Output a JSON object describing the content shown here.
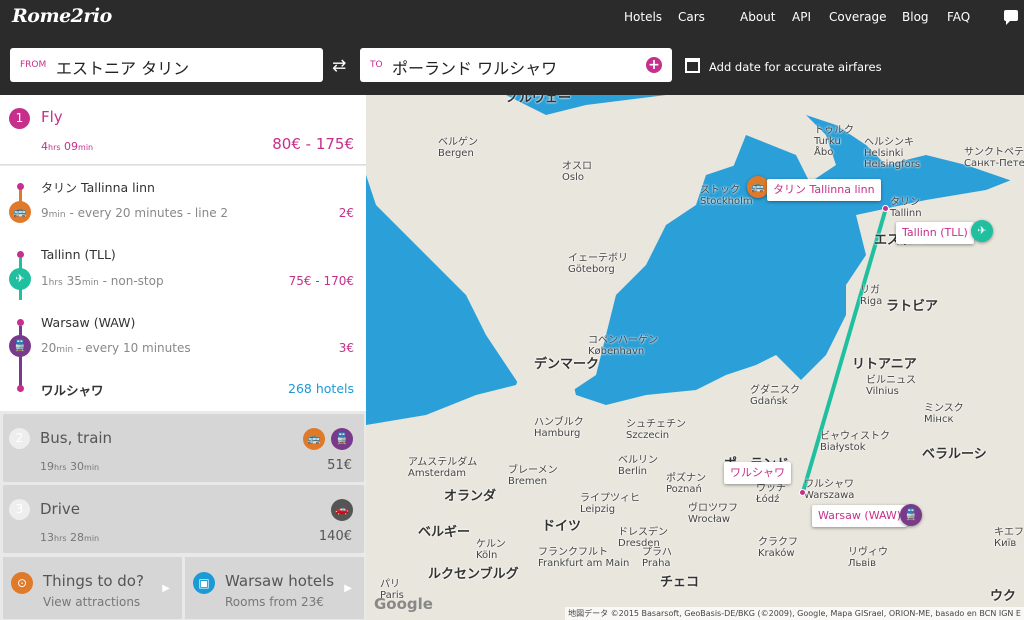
{
  "brand": {
    "name": "Rome2rio"
  },
  "nav": {
    "hotels": "Hotels",
    "cars": "Cars",
    "about": "About",
    "api": "API",
    "coverage": "Coverage",
    "blog": "Blog",
    "faq": "FAQ"
  },
  "search": {
    "from_label": "FROM",
    "from_value": "エストニア タリン",
    "to_label": "TO",
    "to_value": "ポーランド ワルシャワ",
    "date_text": "Add date for accurate airfares",
    "plus": "+"
  },
  "colors": {
    "accent": "#c62f8b",
    "bus": "#e07a2b",
    "plane": "#1fbfa0",
    "train": "#7a3a8c",
    "link": "#1a9bd6",
    "sea": "#2b9fd8"
  },
  "route": {
    "number": "1",
    "title": "Fly",
    "duration_value": "4",
    "duration_unit_h": "hrs",
    "duration_min": "09",
    "duration_unit_m": "min",
    "price": "80€ - 175€",
    "segments": [
      {
        "place_jp": "タリン",
        "place": "Tallinna linn",
        "icon": "bus-icon",
        "info_num": "9",
        "info_unit": "min",
        "info_rest": " - every 20 minutes - line 2",
        "price": "2€"
      },
      {
        "place": "Tallinn (TLL)",
        "icon": "plane-icon",
        "info_num": "1",
        "info_unit": "hrs",
        "info_num2": "35",
        "info_unit2": "min",
        "info_rest": " - non-stop",
        "price": "75€ - 170€"
      },
      {
        "place": "Warsaw (WAW)",
        "icon": "train-icon",
        "info_num": "20",
        "info_unit": "min",
        "info_rest": " - every 10 minutes",
        "price": "3€"
      }
    ],
    "destination": "ワルシャワ",
    "hotels": "268 hotels"
  },
  "options": [
    {
      "number": "2",
      "title": "Bus, train",
      "dur_h": "19",
      "unit_h": "hrs",
      "dur_m": "30",
      "unit_m": "min",
      "price": "51€"
    },
    {
      "number": "3",
      "title": "Drive",
      "dur_h": "13",
      "unit_h": "hrs",
      "dur_m": "28",
      "unit_m": "min",
      "price": "140€"
    }
  ],
  "tiles": [
    {
      "title": "Things to do?",
      "sub": "View attractions"
    },
    {
      "title": "Warsaw hotels",
      "sub": "Rooms from 23€"
    }
  ],
  "map": {
    "labels": {
      "norway": "ノルウェー",
      "bergen_jp": "ベルゲン",
      "bergen": "Bergen",
      "oslo_jp": "オスロ",
      "oslo": "Oslo",
      "stockholm_jp": "ストック",
      "stockholm": "Stockholm",
      "turku_jp": "トゥルク",
      "turku": "Turku",
      "abo": "Åbo",
      "helsinki_jp": "ヘルシンキ",
      "helsinki": "Helsinki",
      "helsingfors": "Helsingfors",
      "spb_jp": "サンクトペテ",
      "spb": "Санкт-Петер",
      "goteborg_jp": "イェーテボリ",
      "goteborg": "Göteborg",
      "estonia": "エストニ",
      "tallinn_jp": "タリン",
      "tallinn": "Tallinn",
      "latvia": "ラトビア",
      "riga_jp": "リガ",
      "riga": "Riga",
      "copenhagen_jp": "コペンハーゲン",
      "copenhagen": "København",
      "denmark": "デンマーク",
      "lithuania": "リトアニア",
      "vilnius_jp": "ビルニュス",
      "vilnius": "Vilnius",
      "gdansk_jp": "グダニスク",
      "gdansk": "Gdańsk",
      "minsk_jp": "ミンスク",
      "minsk": "Мінск",
      "hamburg_jp": "ハンブルク",
      "hamburg": "Hamburg",
      "szczecin_jp": "シュチェチン",
      "szczecin": "Szczecin",
      "bialystok_jp": "ビャウィストク",
      "bialystok": "Białystok",
      "belarus": "ベラルーシ",
      "amsterdam_jp": "アムステルダム",
      "amsterdam": "Amsterdam",
      "bremen_jp": "ブレーメン",
      "bremen": "Bremen",
      "berlin_jp": "ベルリン",
      "berlin": "Berlin",
      "poznan_jp": "ポズナン",
      "poznan": "Poznań",
      "netherlands": "オランダ",
      "leipzig_jp": "ライプツィヒ",
      "leipzig": "Leipzig",
      "lodz_jp": "ウッチ",
      "lodz": "Łódź",
      "wroclaw_jp": "ヴロツワフ",
      "wroclaw": "Wrocław",
      "warszawa_jp": "ワルシャワ",
      "warszawa": "Warszawa",
      "poland": "ポーランド",
      "germany": "ドイツ",
      "belgium": "ベルギー",
      "koln_jp": "ケルン",
      "koln": "Köln",
      "dresden_jp": "ドレスデン",
      "dresden": "Dresden",
      "krakow_jp": "クラクフ",
      "krakow": "Kraków",
      "lviv_jp": "リヴィウ",
      "lviv": "Львів",
      "frankfurt_jp": "フランクフルト",
      "frankfurt": "Frankfurt am Main",
      "praha_jp": "プラハ",
      "praha": "Praha",
      "luxembourg": "ルクセンブルグ",
      "czech": "チェコ",
      "paris_jp": "パリ",
      "paris": "Paris",
      "ukraine": "ウク",
      "kyiv_jp": "キエフ",
      "kyiv": "Київ"
    },
    "pins": {
      "tallinna": "タリン Tallinna linn",
      "tll": "Tallinn (TLL)",
      "warsaw_jp": "ワルシャワ",
      "waw": "Warsaw (WAW)"
    },
    "google": "Google",
    "attribution": "地図データ ©2015 Basarsoft, GeoBasis-DE/BKG (©2009), Google, Mapa GISrael, ORION-ME, basado en BCN IGN E"
  }
}
